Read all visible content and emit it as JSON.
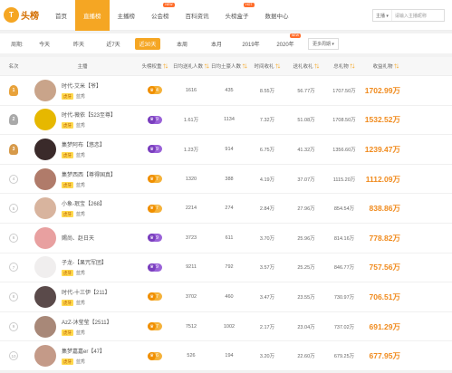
{
  "logo": {
    "badge": "T",
    "text": "头榜"
  },
  "nav": {
    "items": [
      {
        "label": "首页",
        "active": false,
        "badge": ""
      },
      {
        "label": "直播榜",
        "active": true,
        "badge": ""
      },
      {
        "label": "主播榜",
        "active": false,
        "badge": ""
      },
      {
        "label": "公会榜",
        "active": false,
        "badge": "NEW"
      },
      {
        "label": "百科资讯",
        "active": false,
        "badge": ""
      },
      {
        "label": "头榜盒子",
        "active": false,
        "badge": "HOT"
      },
      {
        "label": "数据中心",
        "active": false,
        "badge": ""
      }
    ]
  },
  "search": {
    "select": "主播 ▾",
    "placeholder": "请输入主播昵称"
  },
  "filter": {
    "label": "周期:",
    "items": [
      {
        "label": "今天",
        "active": false,
        "badge": ""
      },
      {
        "label": "昨天",
        "active": false,
        "badge": ""
      },
      {
        "label": "近7天",
        "active": false,
        "badge": ""
      },
      {
        "label": "近30天",
        "active": true,
        "badge": ""
      },
      {
        "label": "本周",
        "active": false,
        "badge": ""
      },
      {
        "label": "本月",
        "active": false,
        "badge": ""
      },
      {
        "label": "2019年",
        "active": false,
        "badge": ""
      },
      {
        "label": "2020年",
        "active": false,
        "badge": "NEW"
      }
    ],
    "more": "更多周期 ▾"
  },
  "table": {
    "headers": [
      "名次",
      "主播",
      "头榜权重",
      "日均送礼人数",
      "日均土豪人数",
      "时间收礼",
      "送礼收礼",
      "总礼物",
      "收益礼物"
    ],
    "rows": [
      {
        "rank": "1",
        "medal": "m1",
        "name": "时代-艾米【爷】",
        "tag": "虎牙",
        "platform": "蓝秀",
        "level": "4",
        "level_color": "y",
        "v1": "1616",
        "v2": "435",
        "v3": "8.55万",
        "v4": "56.77万",
        "v5": "1707.50万",
        "income": "1702.99万",
        "avatar": "#c9a48a"
      },
      {
        "rank": "2",
        "medal": "m2",
        "name": "时代-薇依【523至尊】",
        "tag": "虎牙",
        "platform": "蓝秀",
        "level": "9",
        "level_color": "p",
        "v1": "1.61万",
        "v2": "1134",
        "v3": "7.32万",
        "v4": "51.08万",
        "v5": "1708.50万",
        "income": "1532.52万",
        "avatar": "#e6b800"
      },
      {
        "rank": "3",
        "medal": "m3",
        "name": "集梦阿布【悠恋】",
        "tag": "虎牙",
        "platform": "蓝秀",
        "level": "9",
        "level_color": "p",
        "v1": "1.23万",
        "v2": "914",
        "v3": "6.75万",
        "v4": "41.32万",
        "v5": "1356.60万",
        "income": "1239.47万",
        "avatar": "#3a2a2a"
      },
      {
        "rank": "4",
        "medal": "",
        "name": "集梦西西【尊得国真】",
        "tag": "虎牙",
        "platform": "蓝秀",
        "level": "7",
        "level_color": "y",
        "v1": "1320",
        "v2": "388",
        "v3": "4.19万",
        "v4": "37.07万",
        "v5": "1115.20万",
        "income": "1112.09万",
        "avatar": "#b07b6a"
      },
      {
        "rank": "5",
        "medal": "",
        "name": "小象-珉宝【268】",
        "tag": "虎牙",
        "platform": "蓝秀",
        "level": "7",
        "level_color": "y",
        "v1": "2214",
        "v2": "274",
        "v3": "2.84万",
        "v4": "27.96万",
        "v5": "854.54万",
        "income": "838.86万",
        "avatar": "#d8b49e"
      },
      {
        "rank": "6",
        "medal": "",
        "name": "赐尚、赵日天",
        "tag": "",
        "platform": "",
        "level": "9",
        "level_color": "p",
        "v1": "3723",
        "v2": "611",
        "v3": "3.70万",
        "v4": "25.96万",
        "v5": "814.16万",
        "income": "778.82万",
        "avatar": "#e8a0a0"
      },
      {
        "rank": "7",
        "medal": "",
        "name": "子龙-【果咒军团】",
        "tag": "虎牙",
        "platform": "蓝秀",
        "level": "9",
        "level_color": "p",
        "v1": "9211",
        "v2": "792",
        "v3": "3.57万",
        "v4": "25.25万",
        "v5": "846.77万",
        "income": "757.56万",
        "avatar": "#f0eeee"
      },
      {
        "rank": "8",
        "medal": "",
        "name": "时代-十三伊【211】",
        "tag": "虎牙",
        "platform": "蓝秀",
        "level": "7",
        "level_color": "y",
        "v1": "3702",
        "v2": "460",
        "v3": "3.47万",
        "v4": "23.55万",
        "v5": "730.97万",
        "income": "706.51万",
        "avatar": "#5a4a4a"
      },
      {
        "rank": "9",
        "medal": "",
        "name": "AzZ-沐莹莹【2511】",
        "tag": "虎牙",
        "platform": "蓝秀",
        "level": "7",
        "level_color": "y",
        "v1": "7512",
        "v2": "1002",
        "v3": "2.17万",
        "v4": "23.04万",
        "v5": "737.02万",
        "income": "691.29万",
        "avatar": "#a88878"
      },
      {
        "rank": "10",
        "medal": "",
        "name": "集梦嘉嘉er【47】",
        "tag": "虎牙",
        "platform": "蓝秀",
        "level": "6",
        "level_color": "y",
        "v1": "526",
        "v2": "194",
        "v3": "3.20万",
        "v4": "22.60万",
        "v5": "679.25万",
        "income": "677.95万",
        "avatar": "#c49a88"
      }
    ]
  }
}
